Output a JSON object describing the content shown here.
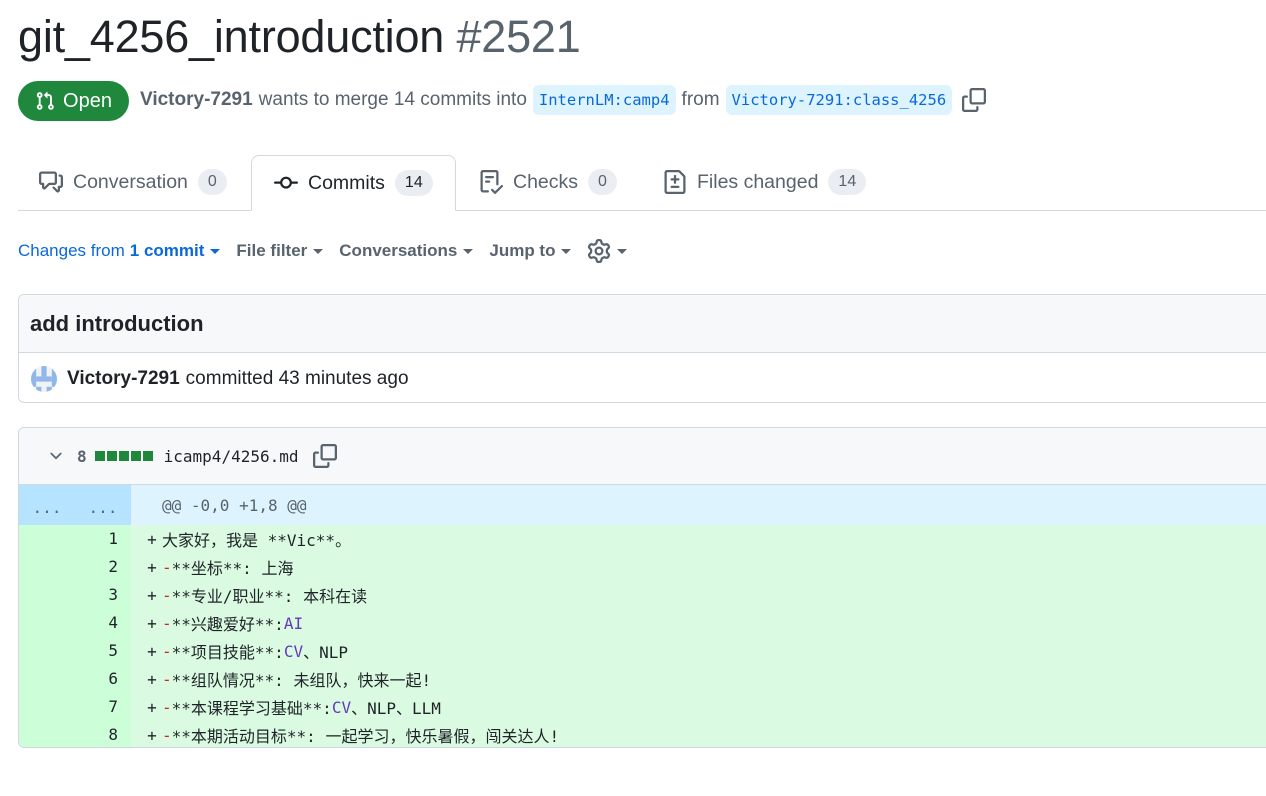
{
  "pr": {
    "title": "git_4256_introduction",
    "number": "#2521",
    "state": "Open",
    "author": "Victory-7291",
    "merge_text": "wants to merge 14 commits into",
    "base_branch": "InternLM:camp4",
    "from_text": "from",
    "head_branch": "Victory-7291:class_4256"
  },
  "tabs": [
    {
      "label": "Conversation",
      "count": "0"
    },
    {
      "label": "Commits",
      "count": "14"
    },
    {
      "label": "Checks",
      "count": "0"
    },
    {
      "label": "Files changed",
      "count": "14"
    }
  ],
  "toolbar": {
    "changes_prefix": "Changes from",
    "changes_value": "1 commit",
    "file_filter": "File filter",
    "conversations": "Conversations",
    "jump_to": "Jump to"
  },
  "commit": {
    "message": "add introduction",
    "author": "Victory-7291",
    "meta": "committed 43 minutes ago"
  },
  "file": {
    "additions": "8",
    "path": "icamp4/4256.md",
    "hunk_header": "@@ -0,0 +1,8 @@",
    "expand_dots": "...",
    "lines": [
      {
        "num": "1",
        "plus": "+",
        "pre": "大家好，我是 **Vic**。"
      },
      {
        "num": "2",
        "plus": "+",
        "dash": "-",
        "pre": " **坐标**: 上海"
      },
      {
        "num": "3",
        "plus": "+",
        "dash": "-",
        "pre": " **专业/职业**: 本科在读"
      },
      {
        "num": "4",
        "plus": "+",
        "dash": "-",
        "pre": " **兴趣爱好**:",
        "kw": "AI"
      },
      {
        "num": "5",
        "plus": "+",
        "dash": "-",
        "pre": " **项目技能**:",
        "kw": "CV",
        "post": "、NLP"
      },
      {
        "num": "6",
        "plus": "+",
        "dash": "-",
        "pre": " **组队情况**: 未组队，快来一起!"
      },
      {
        "num": "7",
        "plus": "+",
        "dash": "-",
        "pre": " **本课程学习基础**:",
        "kw": "CV",
        "post": "、NLP、LLM"
      },
      {
        "num": "8",
        "plus": "+",
        "dash": "-",
        "pre": " **本期活动目标**: 一起学习，快乐暑假，闯关达人!"
      }
    ]
  },
  "colors": {
    "accent": "#0969da",
    "open": "#1f883d",
    "added_bg": "#dafbe1"
  }
}
